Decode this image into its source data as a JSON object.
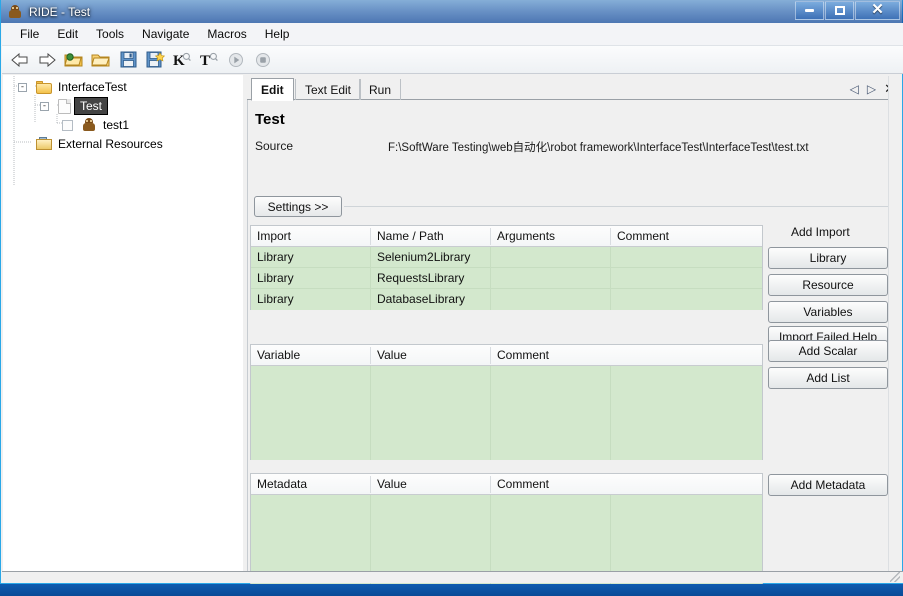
{
  "window": {
    "title": "RIDE - Test",
    "app_icon": "robot-icon",
    "minimize": "–",
    "maximize": "□",
    "close": "✕"
  },
  "menubar": {
    "items": [
      {
        "label": "File"
      },
      {
        "label": "Edit"
      },
      {
        "label": "Tools"
      },
      {
        "label": "Navigate"
      },
      {
        "label": "Macros"
      },
      {
        "label": "Help"
      }
    ]
  },
  "toolbar": {
    "items": [
      {
        "name": "back-arrow-icon",
        "tip": "Back"
      },
      {
        "name": "forward-arrow-icon",
        "tip": "Forward"
      },
      {
        "name": "open-directory-icon",
        "tip": "Open Directory"
      },
      {
        "name": "open-file-icon",
        "tip": "Open"
      },
      {
        "name": "save-icon",
        "tip": "Save"
      },
      {
        "name": "save-all-icon",
        "tip": "Save All"
      },
      {
        "name": "search-keyword-icon",
        "tip": "Search Keywords"
      },
      {
        "name": "search-tests-icon",
        "tip": "Search Tests"
      },
      {
        "name": "run-icon",
        "tip": "Run"
      },
      {
        "name": "stop-icon",
        "tip": "Stop"
      }
    ]
  },
  "tree": {
    "nodes": [
      {
        "label": "InterfaceTest",
        "icon": "folder-icon",
        "expander": "-",
        "level": 0,
        "selected": false
      },
      {
        "label": "Test",
        "icon": "document-icon",
        "expander": "-",
        "level": 1,
        "selected": true
      },
      {
        "label": "test1",
        "icon": "robot-icon",
        "checkbox": true,
        "level": 2,
        "selected": false
      },
      {
        "label": "External Resources",
        "icon": "external-resources-icon",
        "level": 1,
        "selected": false
      }
    ]
  },
  "tabs": {
    "items": [
      {
        "label": "Edit",
        "active": true
      },
      {
        "label": "Text Edit",
        "active": false
      },
      {
        "label": "Run",
        "active": false
      }
    ],
    "nav": {
      "prev": "◁",
      "next": "▷",
      "close": "✕"
    }
  },
  "editor": {
    "title": "Test",
    "source_label": "Source",
    "source_value": "F:\\SoftWare Testing\\web自动化\\robot framework\\InterfaceTest\\InterfaceTest\\test.txt",
    "settings_button": "Settings >>"
  },
  "import_table": {
    "headers": [
      "Import",
      "Name / Path",
      "Arguments",
      "Comment"
    ],
    "rows": [
      [
        "Library",
        "Selenium2Library",
        "",
        ""
      ],
      [
        "Library",
        "RequestsLibrary",
        "",
        ""
      ],
      [
        "Library",
        "DatabaseLibrary",
        "",
        ""
      ]
    ]
  },
  "variable_table": {
    "headers": [
      "Variable",
      "Value",
      "Comment"
    ],
    "rows": []
  },
  "metadata_table": {
    "headers": [
      "Metadata",
      "Value",
      "Comment"
    ],
    "rows": []
  },
  "side_panel": {
    "add_import_label": "Add Import",
    "buttons": [
      {
        "label": "Library",
        "name": "add-library-button"
      },
      {
        "label": "Resource",
        "name": "add-resource-button"
      },
      {
        "label": "Variables",
        "name": "add-variables-button"
      },
      {
        "label": "Import Failed Help",
        "name": "import-failed-help-button"
      },
      {
        "label": "Add Scalar",
        "name": "add-scalar-button"
      },
      {
        "label": "Add List",
        "name": "add-list-button"
      },
      {
        "label": "Add Metadata",
        "name": "add-metadata-button"
      }
    ]
  },
  "colors": {
    "grid_green": "#d3e8cd",
    "panel_gray": "#f0f0f0",
    "accent_blue": "#1664bb",
    "selection": "#444444"
  }
}
